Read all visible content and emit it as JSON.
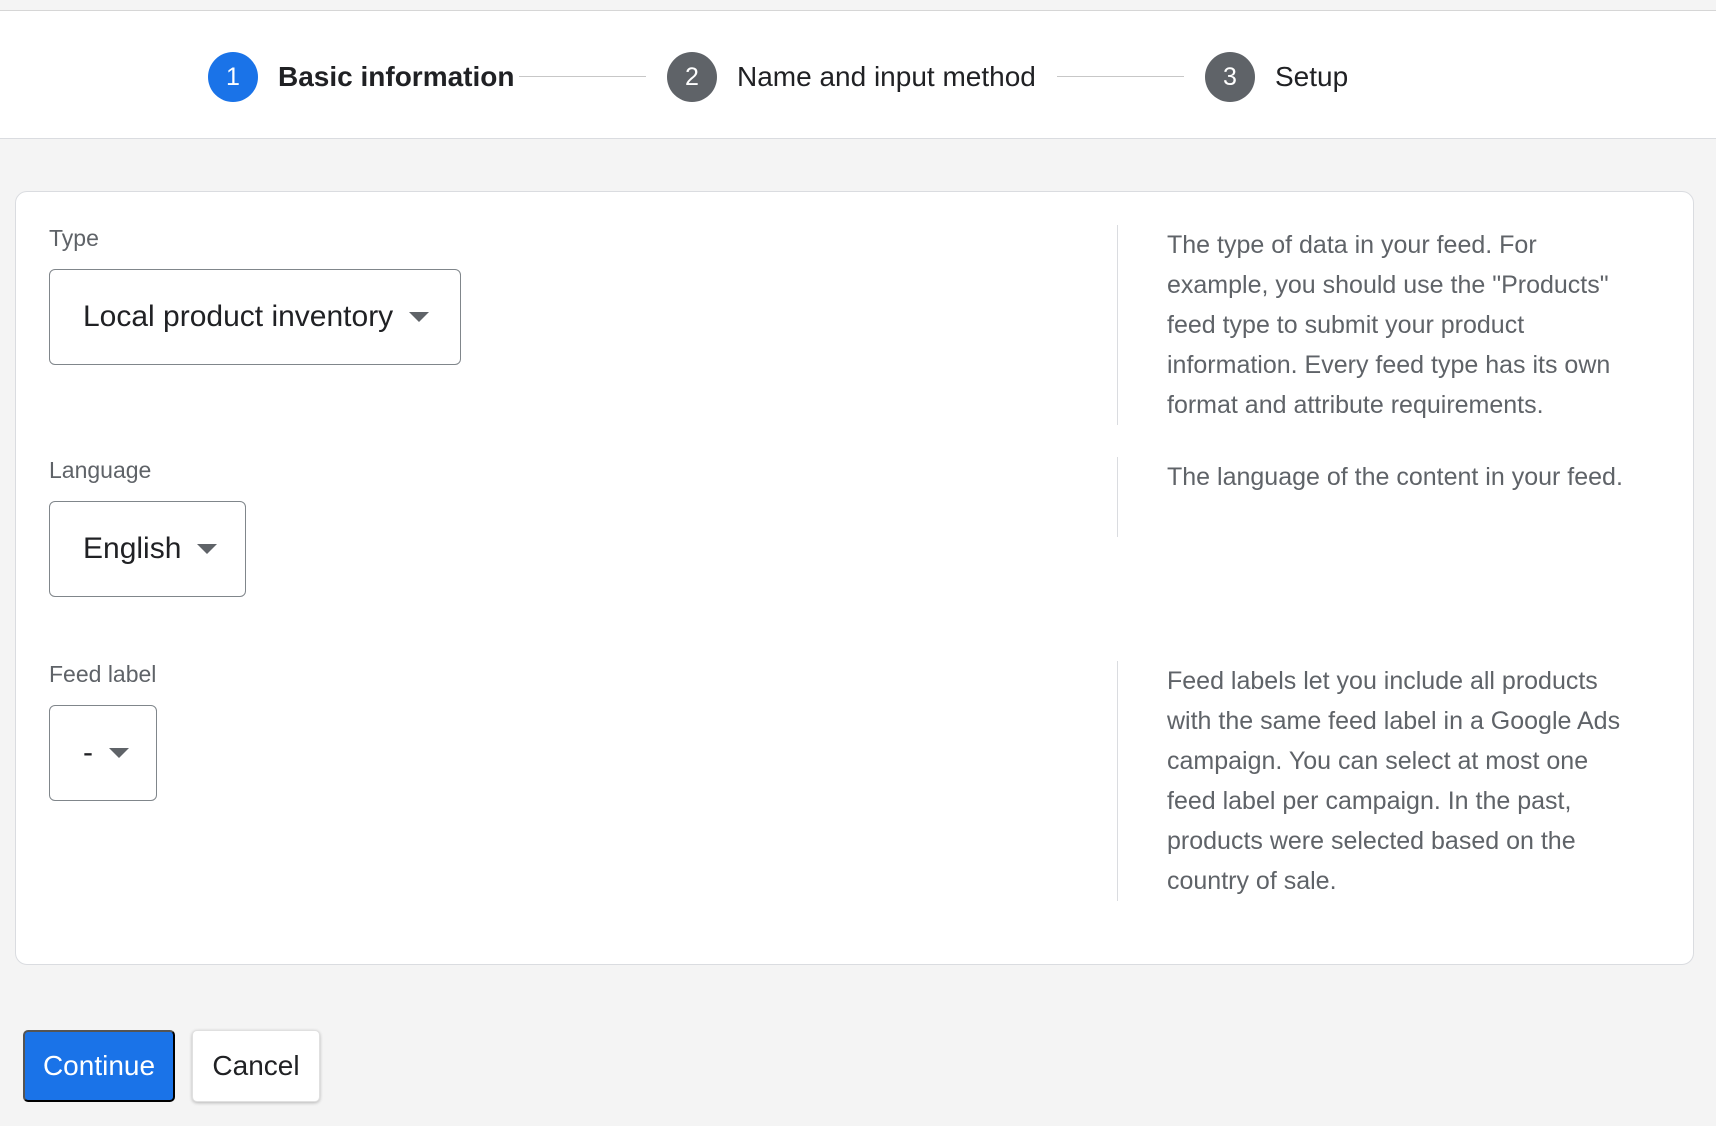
{
  "colors": {
    "accent": "#1a73e8",
    "step_inactive": "#5f6368"
  },
  "stepper": {
    "steps": [
      {
        "number": "1",
        "label": "Basic information",
        "state": "active"
      },
      {
        "number": "2",
        "label": "Name and input method",
        "state": "inactive"
      },
      {
        "number": "3",
        "label": "Setup",
        "state": "inactive"
      }
    ]
  },
  "form": {
    "type": {
      "label": "Type",
      "value": "Local product inventory",
      "help": "The type of data in your feed. For example, you should use the \"Products\" feed type to submit your product information. Every feed type has its own format and attribute requirements."
    },
    "language": {
      "label": "Language",
      "value": "English",
      "help": "The language of the content in your feed."
    },
    "feed_label": {
      "label": "Feed label",
      "value": "-",
      "help": "Feed labels let you include all products with the same feed label in a Google Ads campaign. You can select at most one feed label per campaign. In the past, products were selected based on the country of sale."
    }
  },
  "actions": {
    "continue_label": "Continue",
    "cancel_label": "Cancel"
  }
}
